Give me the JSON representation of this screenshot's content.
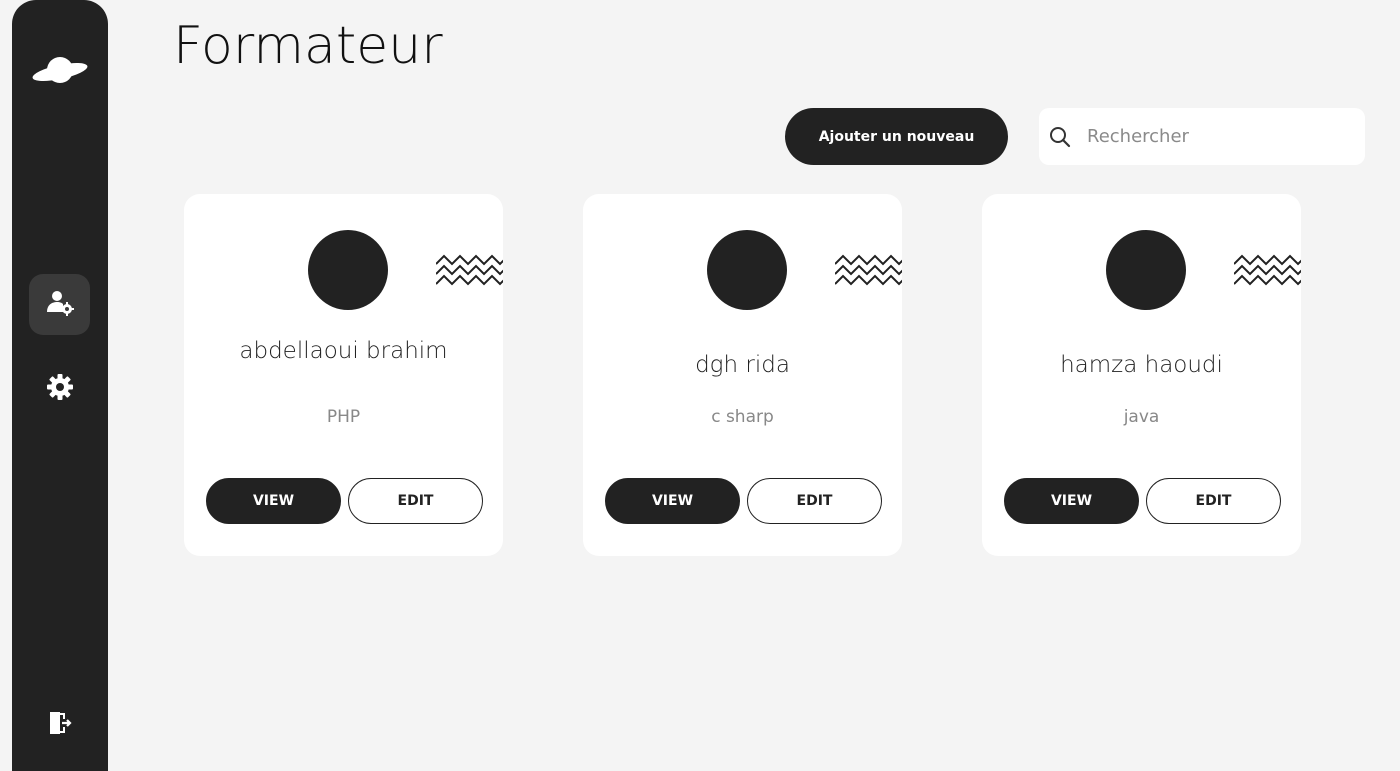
{
  "page": {
    "title": "Formateur"
  },
  "toolbar": {
    "add_label": "Ajouter un nouveau",
    "search_placeholder": "Rechercher",
    "search_value": ""
  },
  "sidebar": {
    "items": [
      {
        "icon": "planet-logo-icon"
      },
      {
        "icon": "user-gear-icon",
        "active": true
      },
      {
        "icon": "gear-icon"
      },
      {
        "icon": "logout-icon"
      }
    ]
  },
  "cards": [
    {
      "name": "abdellaoui brahim",
      "skill": "PHP",
      "view_label": "VIEW",
      "edit_label": "EDIT"
    },
    {
      "name": "dgh rida",
      "skill": "c sharp",
      "view_label": "VIEW",
      "edit_label": "EDIT"
    },
    {
      "name": "hamza haoudi",
      "skill": "java",
      "view_label": "VIEW",
      "edit_label": "EDIT"
    }
  ],
  "colors": {
    "background": "#f4f4f4",
    "sidebar": "#222222",
    "card": "#ffffff",
    "accent": "#222222",
    "muted_text": "#888888"
  }
}
